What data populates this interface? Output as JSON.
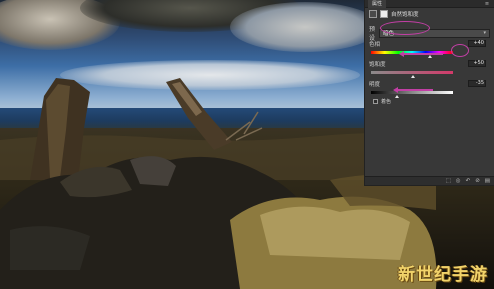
{
  "panel": {
    "title_tab": "属性",
    "menu_glyph": "≡",
    "layer_title": "自然饱和度",
    "preset_label": "预设",
    "preset_value": "暗色",
    "preset_chevron": "▾",
    "sliders": [
      {
        "label": "色相",
        "value": "+40",
        "track": "hue"
      },
      {
        "label": "饱和度",
        "value": "+50",
        "track": "sat"
      },
      {
        "label": "明度",
        "value": "-35",
        "track": "light"
      }
    ],
    "checkbox_label": "着色",
    "footer_buttons": [
      "⬚",
      "◎",
      "↶",
      "⊘",
      "▤"
    ]
  },
  "watermark": "新世纪手游",
  "annotation_color": "#c23fa5"
}
